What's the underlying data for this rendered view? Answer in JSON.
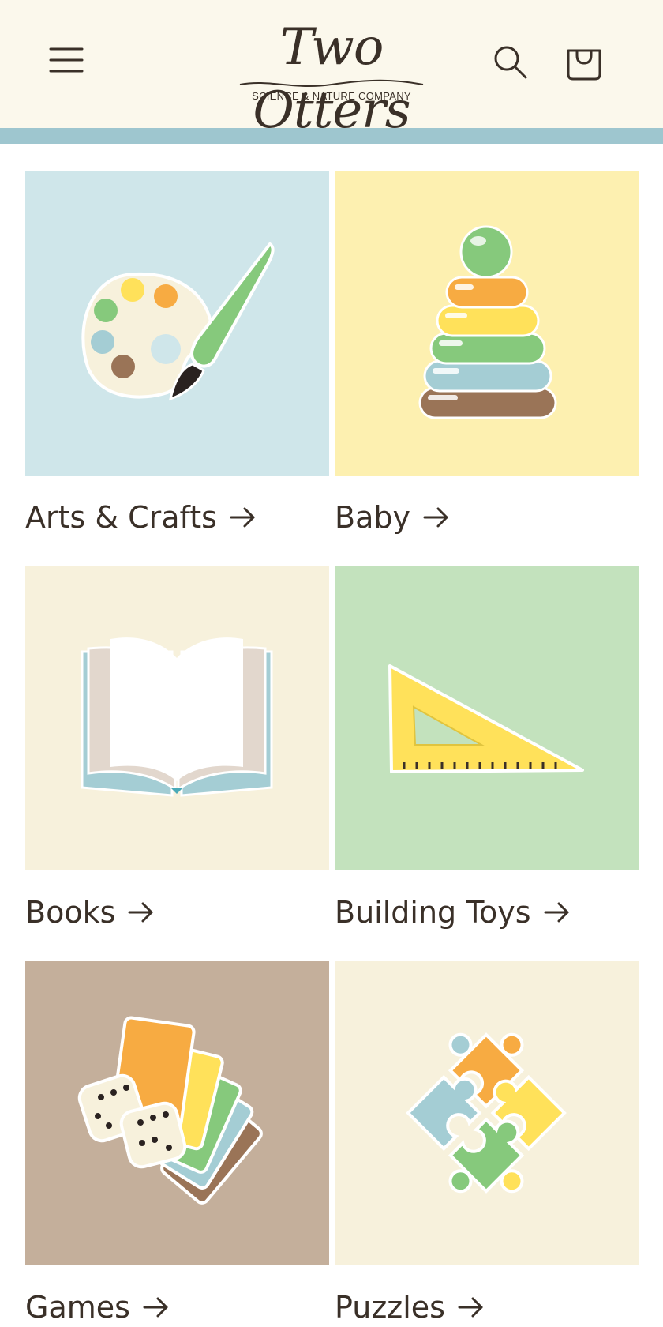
{
  "header": {
    "logo_title": "Two Otters",
    "logo_subtitle": "SCIENCE & NATURE COMPANY",
    "icons": {
      "menu": "hamburger-menu-icon",
      "search": "search-icon",
      "cart": "shopping-bag-icon"
    }
  },
  "colors": {
    "header_bg": "#fbf8ec",
    "band": "#9ec6cf",
    "text": "#3a3028"
  },
  "categories": [
    {
      "label": "Arts & Crafts",
      "tile_color": "#cfe6ea",
      "icon": "palette-brush-icon"
    },
    {
      "label": "Baby",
      "tile_color": "#fdf0b0",
      "icon": "stacking-rings-icon"
    },
    {
      "label": "Books",
      "tile_color": "#f7f1dc",
      "icon": "open-book-icon"
    },
    {
      "label": "Building Toys",
      "tile_color": "#c3e2bd",
      "icon": "set-square-ruler-icon"
    },
    {
      "label": "Games",
      "tile_color": "#c4af9b",
      "icon": "dice-cards-icon"
    },
    {
      "label": "Puzzles",
      "tile_color": "#f7f1dc",
      "icon": "puzzle-pieces-icon"
    }
  ]
}
